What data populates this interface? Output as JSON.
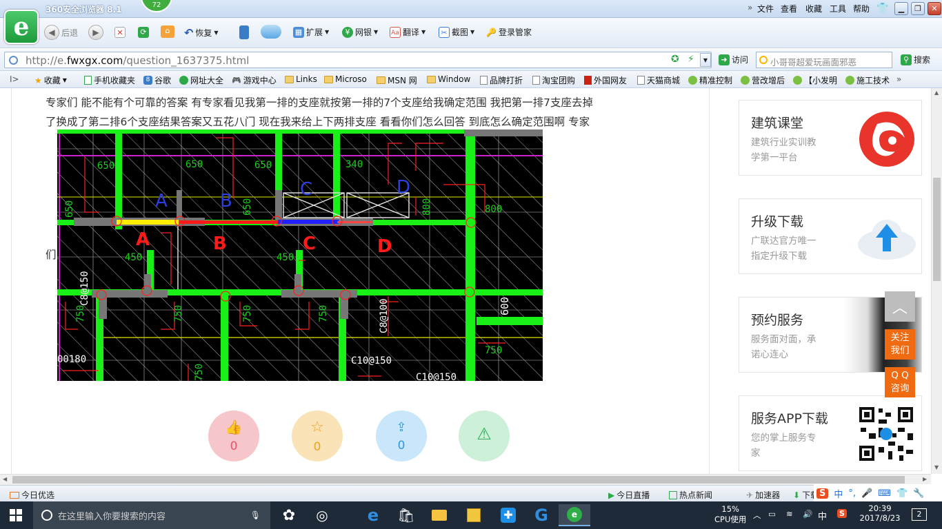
{
  "browser": {
    "title": "360安全浏览器 8.1",
    "badge": "72",
    "menus": [
      "文件",
      "查看",
      "收藏",
      "工具",
      "帮助"
    ]
  },
  "toolbar": {
    "back": "后退",
    "restore": "恢复",
    "extend": "扩展",
    "netbank": "网银",
    "translate": "翻译",
    "screenshot": "截图",
    "login_manager": "登录管家"
  },
  "address": {
    "url_prefix": "http://e.",
    "url_domain": "fwxgx.com",
    "url_path": "/question_1637375.html",
    "go": "访问",
    "search_placeholder": "小哥哥超爱玩画面邪恶",
    "search_button": "搜索"
  },
  "favorites": {
    "collect": "收藏",
    "items": [
      "手机收藏夹",
      "谷歌",
      "网址大全",
      "游戏中心",
      "Links",
      "Microso",
      "MSN 网",
      "Window",
      "品牌打折",
      "淘宝团购",
      "外国网友",
      "天猫商城",
      "精准控制",
      "营改增后",
      "【小发明",
      "施工技术"
    ]
  },
  "question": {
    "line1": "专家们  能不能有个可靠的答案  有专家看见我第一排的支座就按第一排的7个支座给我确定范围  我把第一排7支座去掉",
    "line2": "了换成了第二排6个支座结果答案又五花八门  现在我来给上下两排支座 看看你们怎么回答   到底怎么确定范围啊 专家",
    "line3": "们"
  },
  "drawing": {
    "upper_labels": [
      "A",
      "B",
      "C",
      "D"
    ],
    "lower_labels": [
      "A",
      "B",
      "C",
      "D"
    ],
    "dims": [
      "650",
      "650",
      "650",
      "340",
      "650",
      "650",
      "800",
      "450",
      "450",
      "800",
      "750",
      "750",
      "750",
      "600",
      "750",
      "750",
      "750",
      "750"
    ],
    "rebar": [
      "C8@150",
      "C8@100",
      "C10@150",
      "C10@150",
      "00180"
    ]
  },
  "actions": [
    {
      "icon": "thumb-up",
      "count": "0",
      "color": "#f7c6cb",
      "fg": "#e8546a"
    },
    {
      "icon": "star",
      "count": "0",
      "color": "#fbe3b8",
      "fg": "#f0a321"
    },
    {
      "icon": "share",
      "count": "0",
      "color": "#c9e6fa",
      "fg": "#2f9ae0"
    },
    {
      "icon": "warning",
      "count": "",
      "color": "#cdf0d8",
      "fg": "#2fae5b"
    }
  ],
  "sidebar": {
    "cards": [
      {
        "title": "建筑课堂",
        "sub1": "建筑行业实训教",
        "sub2": "学第一平台"
      },
      {
        "title": "升级下载",
        "sub1": "广联达官方唯一",
        "sub2": "指定升级下载"
      },
      {
        "title": "预约服务",
        "sub1": "服务面对面，承",
        "sub2": "诺心连心"
      },
      {
        "title": "服务APP下载",
        "sub1": "您的掌上服务专",
        "sub2": "家"
      }
    ],
    "follow": [
      "关注",
      "我们"
    ],
    "qq": [
      "Q Q",
      "咨询"
    ]
  },
  "statusbar": {
    "left": "今日优选",
    "items": [
      "今日直播",
      "热点新闻",
      "加速器",
      "下载"
    ],
    "ime": "中"
  },
  "taskbar": {
    "search_placeholder": "在这里输入你要搜索的内容",
    "cpu_percent": "15%",
    "cpu_label": "CPU使用",
    "lang": "中",
    "time": "20:39",
    "date": "2017/8/23",
    "notifications": "2"
  }
}
